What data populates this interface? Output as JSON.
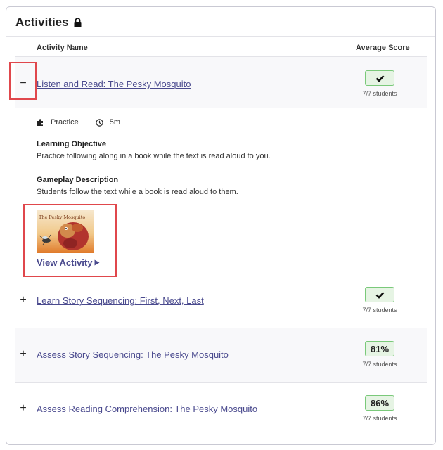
{
  "card": {
    "title": "Activities"
  },
  "table": {
    "col_name": "Activity Name",
    "col_score": "Average Score"
  },
  "expanded": {
    "title": "Listen and Read: The Pesky Mosquito",
    "toggle": "−",
    "score_icon": "check-icon",
    "students": "7/7 students",
    "type": "Practice",
    "duration": "5m",
    "objective_heading": "Learning Objective",
    "objective_text": "Practice following along in a book while the text is read aloud to you.",
    "gameplay_heading": "Gameplay Description",
    "gameplay_text": "Students follow the text while a book is read aloud to them.",
    "cover_title": "The Pesky Mosquito",
    "view_label": "View Activity"
  },
  "rows": [
    {
      "title": "Learn Story Sequencing: First, Next, Last",
      "toggle": "+",
      "score": "",
      "score_icon": "check-icon",
      "students": "7/7 students"
    },
    {
      "title": "Assess Story Sequencing: The Pesky Mosquito",
      "toggle": "+",
      "score": "81%",
      "students": "7/7 students"
    },
    {
      "title": "Assess Reading Comprehension: The Pesky Mosquito",
      "toggle": "+",
      "score": "86%",
      "students": "7/7 students"
    }
  ],
  "colors": {
    "link": "#4a4a8e",
    "badge_bg": "#e6f4e4",
    "badge_border": "#7ac97a",
    "highlight": "#e0474c"
  }
}
